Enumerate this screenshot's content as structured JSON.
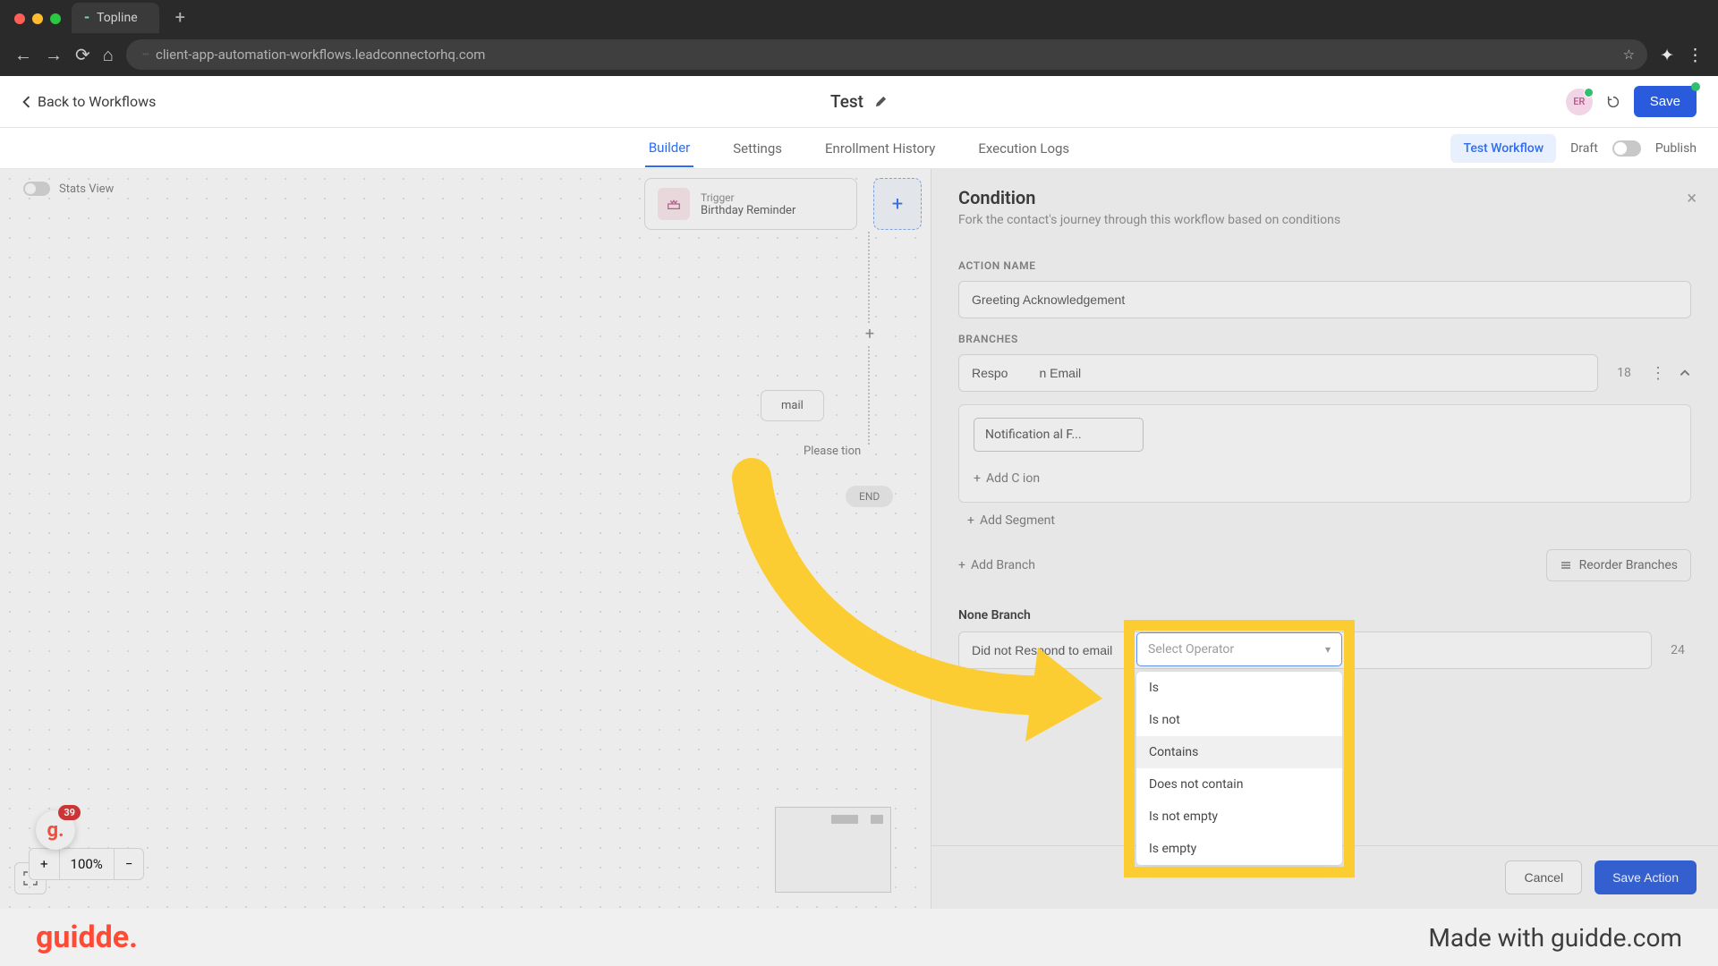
{
  "browser": {
    "tab_title": "Topline",
    "url": "client-app-automation-workflows.leadconnectorhq.com"
  },
  "header": {
    "back_label": "Back to Workflows",
    "title": "Test",
    "avatar_initials": "ER",
    "save_label": "Save"
  },
  "tabs": {
    "builder": "Builder",
    "settings": "Settings",
    "enrollment": "Enrollment History",
    "execution": "Execution Logs",
    "test_workflow": "Test Workflow",
    "draft": "Draft",
    "publish": "Publish"
  },
  "canvas": {
    "stats_view": "Stats View",
    "trigger_label": "Trigger",
    "trigger_name": "Birthday Reminder",
    "email_node": "mail",
    "cond_label": "Please          tion",
    "end_label": "END",
    "zoom": "100%"
  },
  "g_badge": {
    "count": "39"
  },
  "panel": {
    "title": "Condition",
    "subtitle": "Fork the contact's journey through this workflow based on conditions",
    "action_name_label": "ACTION NAME",
    "action_name_value": "Greeting Acknowledgement",
    "branches_label": "BRANCHES",
    "branch": {
      "name": "Respo         n Email",
      "count": "18",
      "cond_field_value": "Notification     al F..."
    },
    "add_condition": "Add C      ion",
    "add_segment": "Add Segment",
    "add_branch": "Add Branch",
    "reorder": "Reorder Branches",
    "none_branch_label": "None Branch",
    "none_branch_name": "Did not Respond to email",
    "none_branch_count": "24",
    "cancel": "Cancel",
    "save_action": "Save Action"
  },
  "dropdown": {
    "placeholder": "Select Operator",
    "items": [
      "Is",
      "Is not",
      "Contains",
      "Does not contain",
      "Is not empty",
      "Is empty"
    ],
    "hover_index": 2
  },
  "footer": {
    "logo": "guidde.",
    "made_with": "Made with guidde.com"
  }
}
